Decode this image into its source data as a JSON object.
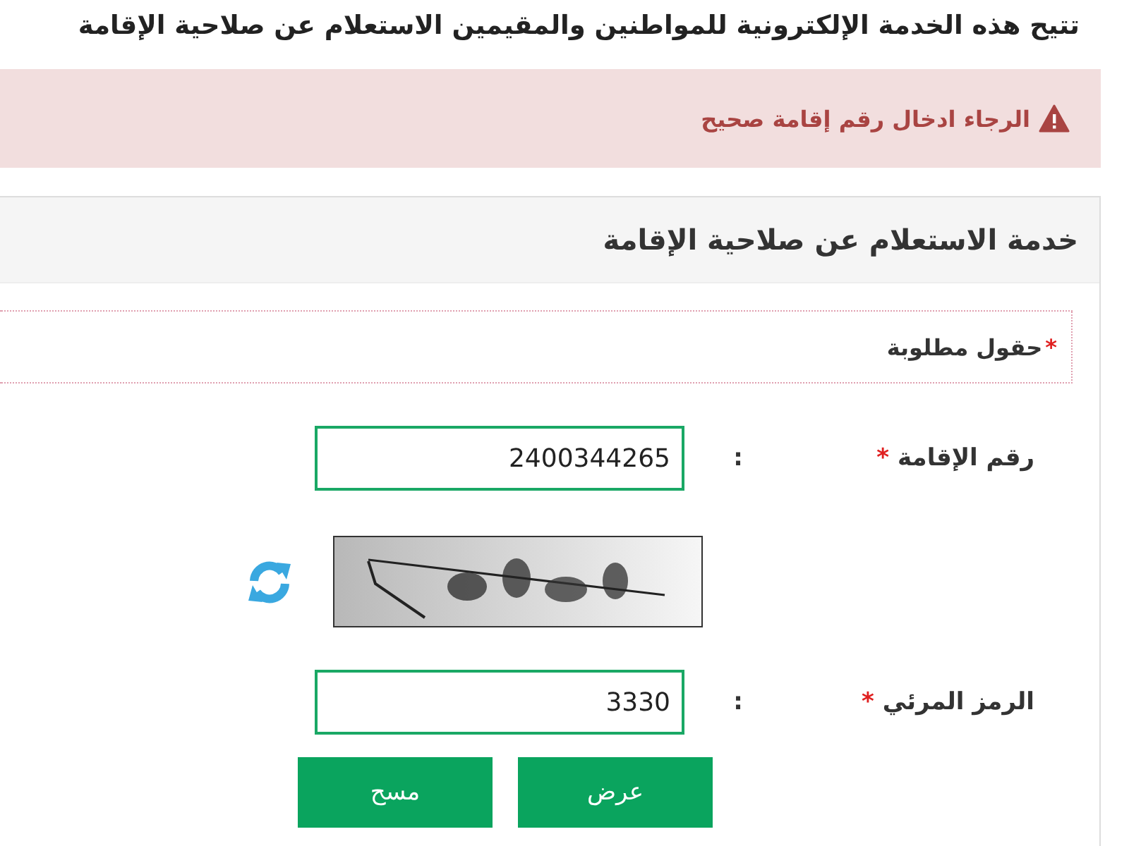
{
  "intro": "تتيح هذه الخدمة الإلكترونية للمواطنين والمقيمين الاستعلام عن صلاحية الإقامة",
  "alert": {
    "kind": "error",
    "message": "الرجاء ادخال رقم إقامة صحيح"
  },
  "panel": {
    "title": "خدمة الاستعلام عن صلاحية الإقامة",
    "required_note": {
      "marker": "*",
      "text": "حقول مطلوبة"
    },
    "fields": [
      {
        "kind": "text",
        "label": "رقم الإقامة",
        "required_marker": "*",
        "separator": ":",
        "value": "2400344265"
      },
      {
        "kind": "captcha"
      },
      {
        "kind": "text",
        "label": "الرمز المرئي",
        "required_marker": "*",
        "separator": ":",
        "value": "3330"
      }
    ],
    "buttons": [
      {
        "label": "عرض"
      },
      {
        "label": "مسح"
      }
    ]
  }
}
